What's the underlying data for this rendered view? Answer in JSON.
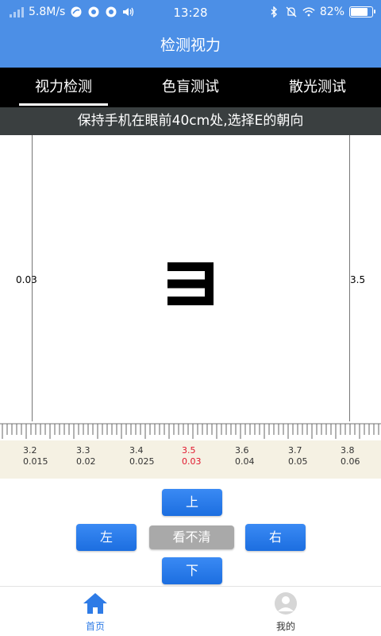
{
  "status_bar": {
    "network_speed": "5.8M/s",
    "time": "13:28",
    "battery": "82%",
    "battery_level": 0.82
  },
  "header": {
    "title": "检测视力"
  },
  "tabs": [
    {
      "label": "视力检测",
      "active": true
    },
    {
      "label": "色盲测试",
      "active": false
    },
    {
      "label": "散光测试",
      "active": false
    }
  ],
  "instruction": "保持手机在眼前40cm处,选择E的朝向",
  "chart": {
    "left_value": "0.03",
    "right_value": "3.5",
    "e_direction": "left"
  },
  "ruler": {
    "marks": [
      {
        "top": "3.2",
        "bottom": "0.015",
        "selected": false
      },
      {
        "top": "3.3",
        "bottom": "0.02",
        "selected": false
      },
      {
        "top": "3.4",
        "bottom": "0.025",
        "selected": false
      },
      {
        "top": "3.5",
        "bottom": "0.03",
        "selected": true
      },
      {
        "top": "3.6",
        "bottom": "0.04",
        "selected": false
      },
      {
        "top": "3.7",
        "bottom": "0.05",
        "selected": false
      },
      {
        "top": "3.8",
        "bottom": "0.06",
        "selected": false
      }
    ],
    "selected_color": "#e0162d"
  },
  "controls": {
    "up": "上",
    "left": "左",
    "unclear": "看不清",
    "right": "右",
    "down": "下"
  },
  "bottom_nav": {
    "home": "首页",
    "mine": "我的",
    "active_color": "#2e7be6"
  },
  "colors": {
    "primary": "#4c8fe6",
    "tab_bar": "#000000",
    "button": "#2a7cea"
  }
}
